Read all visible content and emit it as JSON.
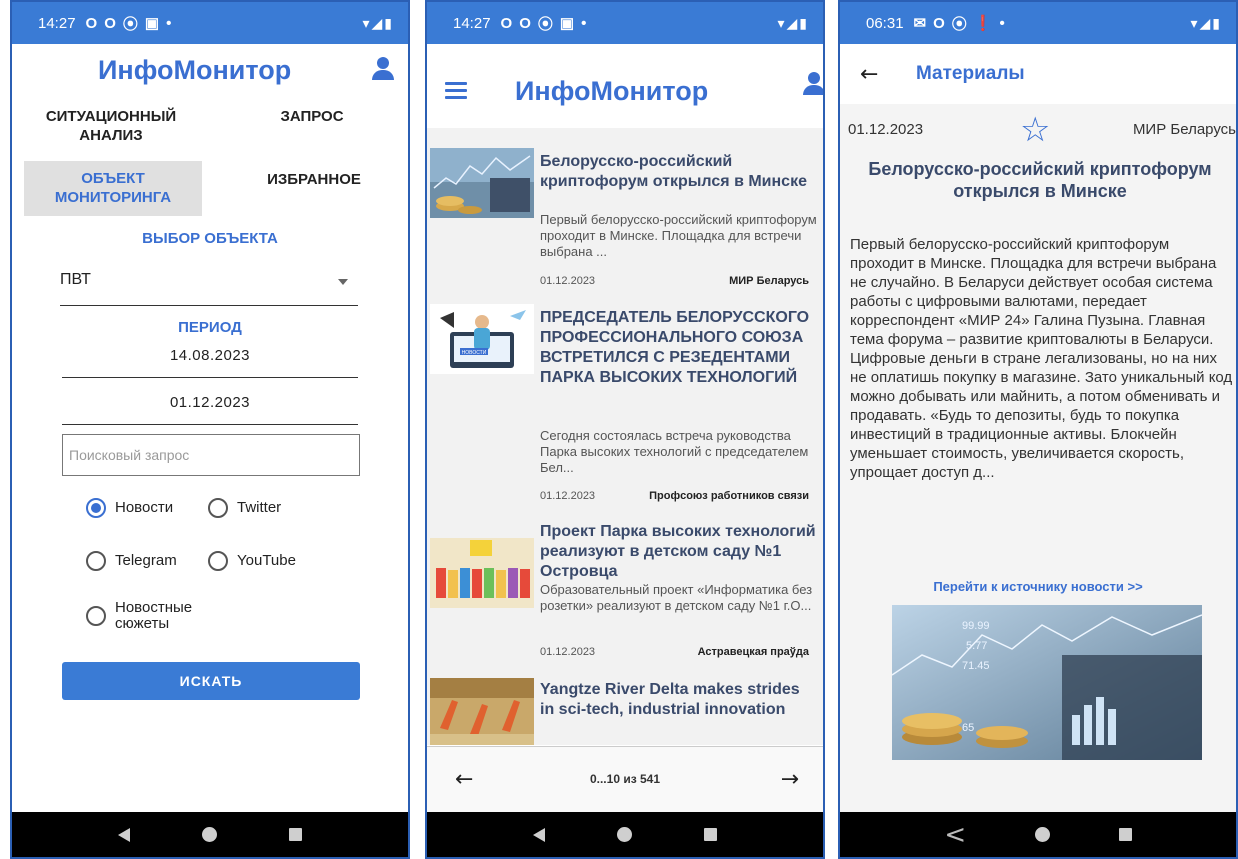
{
  "screens": [
    {
      "status": {
        "time": "14:27",
        "icons": [
          "O",
          "O",
          "⦿",
          "▣",
          "•"
        ],
        "right": "▾◢▮"
      },
      "app_title": "ИнфоМонитор",
      "tabs": [
        {
          "label": "СИТУАЦИОННЫЙ АНАЛИЗ"
        },
        {
          "label": "ЗАПРОС"
        },
        {
          "label": "ОБЪЕКТ МОНИТОРИНГА"
        },
        {
          "label": "ИЗБРАННОЕ"
        }
      ],
      "object_label": "ВЫБОР ОБЪЕКТА",
      "object_value": "ПВТ",
      "period_label": "ПЕРИОД",
      "date_from": "14.08.2023",
      "date_to": "01.12.2023",
      "search_placeholder": "Поисковый запрос",
      "sources": [
        {
          "label": "Новости",
          "checked": true
        },
        {
          "label": "Twitter",
          "checked": false
        },
        {
          "label": "Telegram",
          "checked": false
        },
        {
          "label": "YouTube",
          "checked": false
        },
        {
          "label": "Новостные сюжеты",
          "checked": false
        }
      ],
      "search_button": "ИСКАТЬ"
    },
    {
      "status": {
        "time": "14:27",
        "icons": [
          "O",
          "O",
          "⦿",
          "▣",
          "•"
        ],
        "right": "▾◢▮"
      },
      "app_title": "ИнфоМонитор",
      "articles": [
        {
          "title": "Белорусско-российский криптофорум открылся в Минске",
          "desc": "Первый белорусско-российский криптофорум проходит в Минске. Площадка для встречи выбрана ...",
          "date": "01.12.2023",
          "source": "МИР Беларусь"
        },
        {
          "title": "ПРЕДСЕДАТЕЛЬ БЕЛОРУССКОГО ПРОФЕССИОНАЛЬНОГО СОЮЗА ВСТРЕТИЛСЯ С РЕЗЕДЕНТАМИ ПАРКА ВЫСОКИХ ТЕХНОЛОГИЙ",
          "desc": "Сегодня состоялась встреча руководства Парка высоких технологий с председателем Бел...",
          "date": "01.12.2023",
          "source": "Профсоюз работников связи"
        },
        {
          "title": "Проект Парка высоких технологий реализуют в детском саду №1 Островца",
          "desc": "Образовательный проект «Информатика без розетки» реализуют в детском саду №1 г.О...",
          "date": "01.12.2023",
          "source": "Астравецкая праўда"
        },
        {
          "title": "Yangtze River Delta makes strides in sci-tech, industrial innovation",
          "desc": "",
          "date": "",
          "source": ""
        }
      ],
      "thumb_caption": "НОВОСТИ",
      "pager": {
        "prev": "←",
        "info": "0...10 из 541",
        "next": "→"
      }
    },
    {
      "status": {
        "time": "06:31",
        "icons": [
          "✉",
          "O",
          "⦿",
          "❗",
          "•"
        ],
        "right": "▾◢▮"
      },
      "back": "←",
      "page_title": "Материалы",
      "date": "01.12.2023",
      "star": "☆",
      "source": "МИР Беларусь",
      "title": "Белорусско-российский криптофорум открылся в Минске",
      "body": "Первый белорусско-российский криптофорум проходит в Минске. Площадка для встречи выбрана не случайно. В Беларуси действует особая система работы с цифровыми валютами, передает корреспондент «МИР 24» Галина Пузына. Главная тема форума – развитие криптовалюты в Беларуси. Цифровые деньги в стране легализованы, но на них не оплатишь покупку в магазине. Зато уникальный код можно добывать или майнить, а потом обменивать и продавать. «Будь то депозиты, будь то покупка инвестиций в традиционные активы. Блокчейн уменьшает стоимость, увеличивается скорость, упрощает доступ д...",
      "source_link": "Перейти к источнику новости >>",
      "image_numbers": [
        "99.99",
        "5.77",
        "71.45",
        "65"
      ]
    }
  ],
  "colors": {
    "accent": "#3a7bd5",
    "title_blue": "#3a6fd1",
    "article_title": "#3a4a6b",
    "frame": "#2b5fb4"
  }
}
